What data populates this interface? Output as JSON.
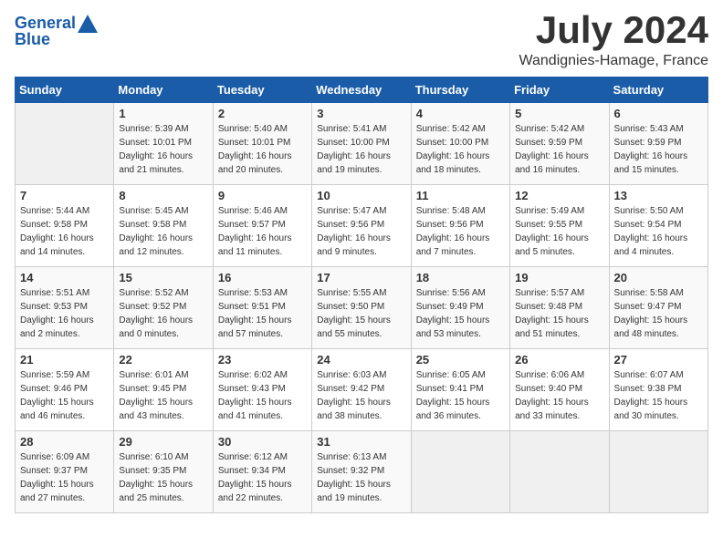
{
  "header": {
    "logo_line1": "General",
    "logo_line2": "Blue",
    "month_year": "July 2024",
    "location": "Wandignies-Hamage, France"
  },
  "days_of_week": [
    "Sunday",
    "Monday",
    "Tuesday",
    "Wednesday",
    "Thursday",
    "Friday",
    "Saturday"
  ],
  "weeks": [
    [
      {
        "day": "",
        "info": ""
      },
      {
        "day": "1",
        "info": "Sunrise: 5:39 AM\nSunset: 10:01 PM\nDaylight: 16 hours\nand 21 minutes."
      },
      {
        "day": "2",
        "info": "Sunrise: 5:40 AM\nSunset: 10:01 PM\nDaylight: 16 hours\nand 20 minutes."
      },
      {
        "day": "3",
        "info": "Sunrise: 5:41 AM\nSunset: 10:00 PM\nDaylight: 16 hours\nand 19 minutes."
      },
      {
        "day": "4",
        "info": "Sunrise: 5:42 AM\nSunset: 10:00 PM\nDaylight: 16 hours\nand 18 minutes."
      },
      {
        "day": "5",
        "info": "Sunrise: 5:42 AM\nSunset: 9:59 PM\nDaylight: 16 hours\nand 16 minutes."
      },
      {
        "day": "6",
        "info": "Sunrise: 5:43 AM\nSunset: 9:59 PM\nDaylight: 16 hours\nand 15 minutes."
      }
    ],
    [
      {
        "day": "7",
        "info": "Sunrise: 5:44 AM\nSunset: 9:58 PM\nDaylight: 16 hours\nand 14 minutes."
      },
      {
        "day": "8",
        "info": "Sunrise: 5:45 AM\nSunset: 9:58 PM\nDaylight: 16 hours\nand 12 minutes."
      },
      {
        "day": "9",
        "info": "Sunrise: 5:46 AM\nSunset: 9:57 PM\nDaylight: 16 hours\nand 11 minutes."
      },
      {
        "day": "10",
        "info": "Sunrise: 5:47 AM\nSunset: 9:56 PM\nDaylight: 16 hours\nand 9 minutes."
      },
      {
        "day": "11",
        "info": "Sunrise: 5:48 AM\nSunset: 9:56 PM\nDaylight: 16 hours\nand 7 minutes."
      },
      {
        "day": "12",
        "info": "Sunrise: 5:49 AM\nSunset: 9:55 PM\nDaylight: 16 hours\nand 5 minutes."
      },
      {
        "day": "13",
        "info": "Sunrise: 5:50 AM\nSunset: 9:54 PM\nDaylight: 16 hours\nand 4 minutes."
      }
    ],
    [
      {
        "day": "14",
        "info": "Sunrise: 5:51 AM\nSunset: 9:53 PM\nDaylight: 16 hours\nand 2 minutes."
      },
      {
        "day": "15",
        "info": "Sunrise: 5:52 AM\nSunset: 9:52 PM\nDaylight: 16 hours\nand 0 minutes."
      },
      {
        "day": "16",
        "info": "Sunrise: 5:53 AM\nSunset: 9:51 PM\nDaylight: 15 hours\nand 57 minutes."
      },
      {
        "day": "17",
        "info": "Sunrise: 5:55 AM\nSunset: 9:50 PM\nDaylight: 15 hours\nand 55 minutes."
      },
      {
        "day": "18",
        "info": "Sunrise: 5:56 AM\nSunset: 9:49 PM\nDaylight: 15 hours\nand 53 minutes."
      },
      {
        "day": "19",
        "info": "Sunrise: 5:57 AM\nSunset: 9:48 PM\nDaylight: 15 hours\nand 51 minutes."
      },
      {
        "day": "20",
        "info": "Sunrise: 5:58 AM\nSunset: 9:47 PM\nDaylight: 15 hours\nand 48 minutes."
      }
    ],
    [
      {
        "day": "21",
        "info": "Sunrise: 5:59 AM\nSunset: 9:46 PM\nDaylight: 15 hours\nand 46 minutes."
      },
      {
        "day": "22",
        "info": "Sunrise: 6:01 AM\nSunset: 9:45 PM\nDaylight: 15 hours\nand 43 minutes."
      },
      {
        "day": "23",
        "info": "Sunrise: 6:02 AM\nSunset: 9:43 PM\nDaylight: 15 hours\nand 41 minutes."
      },
      {
        "day": "24",
        "info": "Sunrise: 6:03 AM\nSunset: 9:42 PM\nDaylight: 15 hours\nand 38 minutes."
      },
      {
        "day": "25",
        "info": "Sunrise: 6:05 AM\nSunset: 9:41 PM\nDaylight: 15 hours\nand 36 minutes."
      },
      {
        "day": "26",
        "info": "Sunrise: 6:06 AM\nSunset: 9:40 PM\nDaylight: 15 hours\nand 33 minutes."
      },
      {
        "day": "27",
        "info": "Sunrise: 6:07 AM\nSunset: 9:38 PM\nDaylight: 15 hours\nand 30 minutes."
      }
    ],
    [
      {
        "day": "28",
        "info": "Sunrise: 6:09 AM\nSunset: 9:37 PM\nDaylight: 15 hours\nand 27 minutes."
      },
      {
        "day": "29",
        "info": "Sunrise: 6:10 AM\nSunset: 9:35 PM\nDaylight: 15 hours\nand 25 minutes."
      },
      {
        "day": "30",
        "info": "Sunrise: 6:12 AM\nSunset: 9:34 PM\nDaylight: 15 hours\nand 22 minutes."
      },
      {
        "day": "31",
        "info": "Sunrise: 6:13 AM\nSunset: 9:32 PM\nDaylight: 15 hours\nand 19 minutes."
      },
      {
        "day": "",
        "info": ""
      },
      {
        "day": "",
        "info": ""
      },
      {
        "day": "",
        "info": ""
      }
    ]
  ]
}
